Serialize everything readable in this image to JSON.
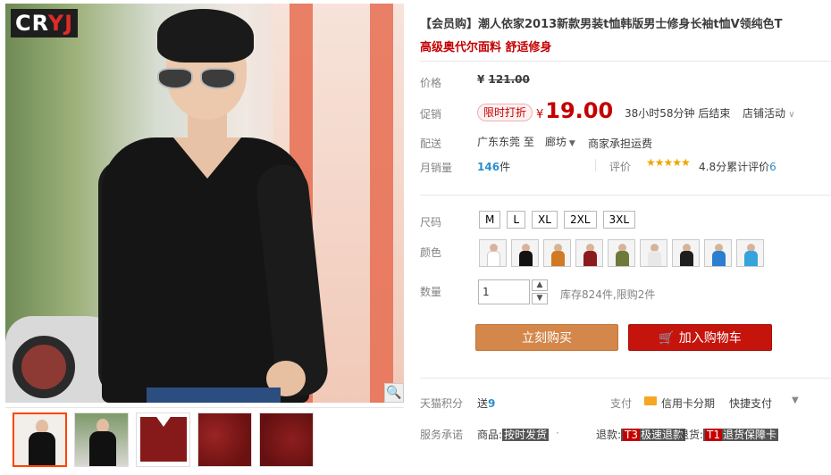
{
  "gallery": {
    "logo_white": "CR",
    "logo_red": "YJ",
    "zoom_icon": "magnifier-icon",
    "thumbnail_count": 5
  },
  "product": {
    "title": "【会员购】潮人依家2013新款男装t恤韩版男士修身长袖t恤V领纯色T",
    "subtitle": "高级奥代尔面料 舒适修身"
  },
  "price": {
    "label": "价格",
    "currency": "¥",
    "original": "121.00"
  },
  "promo": {
    "label": "促销",
    "tag": "限时打折",
    "currency": "¥",
    "price": "19.00",
    "countdown": "38小时58分钟 后结束",
    "shop_activity": "店铺活动"
  },
  "shipping": {
    "label": "配送",
    "from": "广东东莞",
    "to_prefix": "至",
    "to": "廊坊",
    "fee": "商家承担运费"
  },
  "sales": {
    "label": "月销量",
    "count": "146",
    "unit": "件",
    "rating_label": "评价",
    "stars": "★★★★★",
    "score": "4.8分",
    "review_prefix": "累计评价",
    "review_count": "6"
  },
  "sizes": {
    "label": "尺码",
    "options": [
      "M",
      "L",
      "XL",
      "2XL",
      "3XL"
    ]
  },
  "colors": {
    "label": "颜色",
    "swatches": [
      "#ffffff",
      "#121212",
      "#d07a23",
      "#8c1b1b",
      "#6e7a3a",
      "#e8e8e8",
      "#1e1e1e",
      "#2a7fd0",
      "#35a3dc"
    ]
  },
  "quantity": {
    "label": "数量",
    "value": "1",
    "stock": "库存824件,限购2件"
  },
  "actions": {
    "buy_now": "立刻购买",
    "add_to_cart": "加入购物车"
  },
  "points": {
    "label": "天猫积分",
    "prefix": "送",
    "value": "9",
    "pay_label": "支付",
    "credit": "信用卡分期",
    "quick_pay": "快捷支付",
    "quick_pay_arrow": "▼"
  },
  "services": {
    "label": "服务承诺",
    "items": [
      {
        "prefix": "商品:",
        "code": "",
        "text": "按时发货"
      },
      {
        "prefix": "退款:",
        "code": "T3",
        "text": "极速退款"
      },
      {
        "prefix": "退货:",
        "code": "T1",
        "text": "退货保障卡"
      }
    ]
  }
}
